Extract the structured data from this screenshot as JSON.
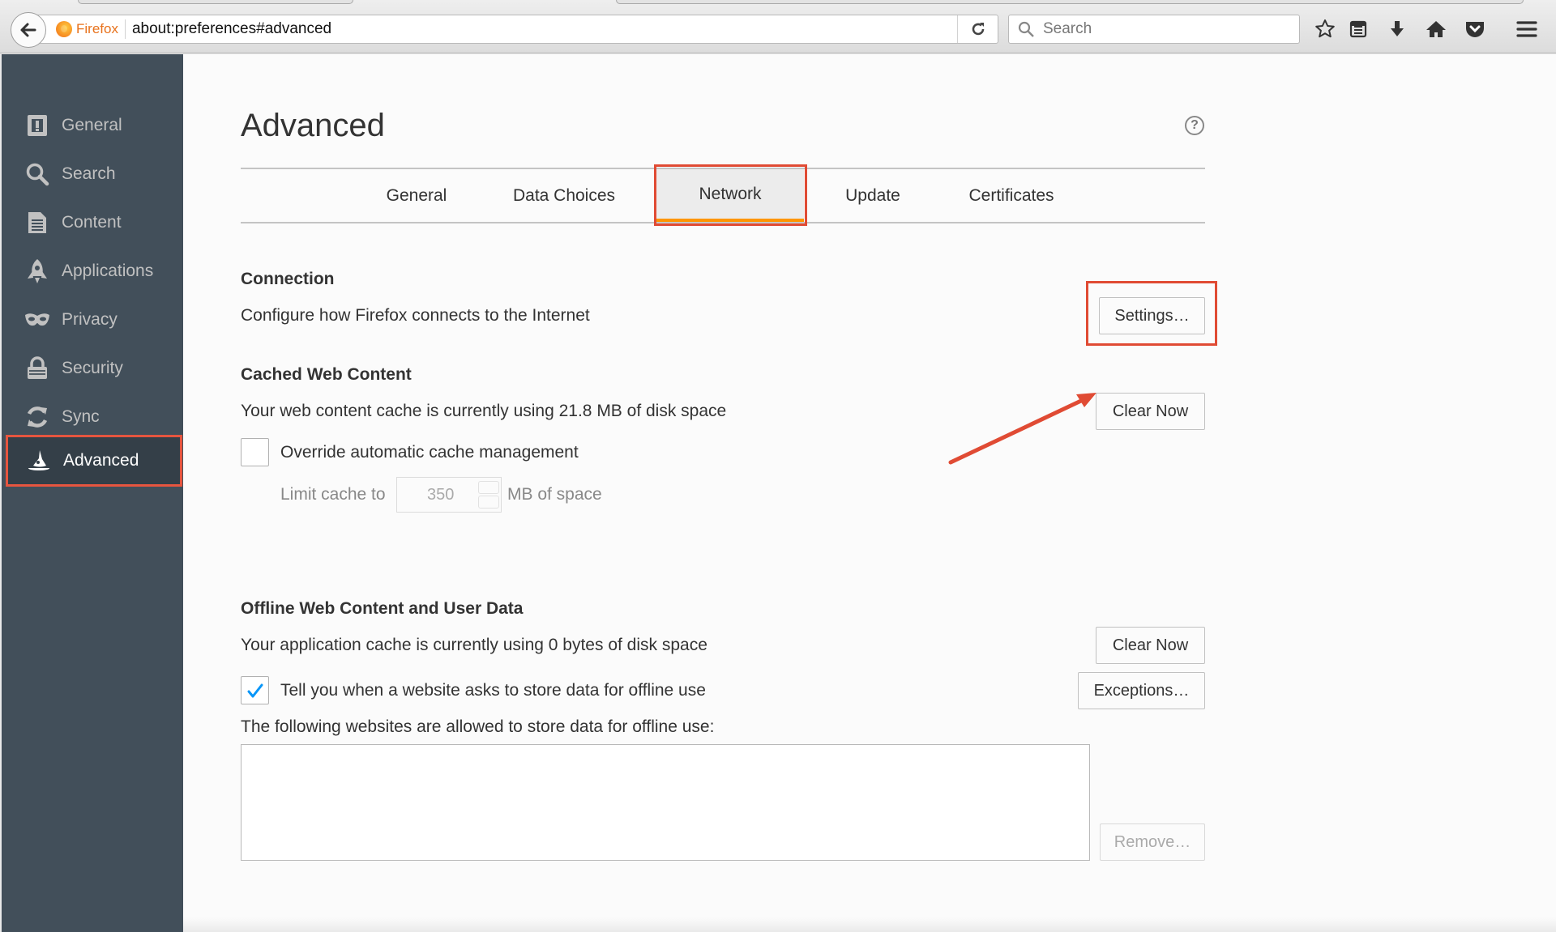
{
  "browser": {
    "identity_label": "Firefox",
    "url": "about:preferences#advanced",
    "search_placeholder": "Search"
  },
  "sidebar": {
    "items": [
      {
        "label": "General",
        "icon": "general-icon"
      },
      {
        "label": "Search",
        "icon": "search-icon"
      },
      {
        "label": "Content",
        "icon": "content-icon"
      },
      {
        "label": "Applications",
        "icon": "applications-icon"
      },
      {
        "label": "Privacy",
        "icon": "privacy-mask-icon"
      },
      {
        "label": "Security",
        "icon": "security-lock-icon"
      },
      {
        "label": "Sync",
        "icon": "sync-icon"
      },
      {
        "label": "Advanced",
        "icon": "advanced-wizard-icon",
        "selected": true
      }
    ]
  },
  "main": {
    "title": "Advanced",
    "tabs": [
      {
        "label": "General"
      },
      {
        "label": "Data Choices"
      },
      {
        "label": "Network",
        "selected": true
      },
      {
        "label": "Update"
      },
      {
        "label": "Certificates"
      }
    ],
    "connection": {
      "heading": "Connection",
      "description": "Configure how Firefox connects to the Internet",
      "settings_label": "Settings…"
    },
    "cache": {
      "heading": "Cached Web Content",
      "description": "Your web content cache is currently using 21.8 MB of disk space",
      "clear_label": "Clear Now",
      "override_label": "Override automatic cache management",
      "override_checked": false,
      "limit_label": "Limit cache to",
      "limit_value": "350",
      "limit_unit": "MB of space"
    },
    "offline": {
      "heading": "Offline Web Content and User Data",
      "description": "Your application cache is currently using 0 bytes of disk space",
      "clear_label": "Clear Now",
      "notify_label": "Tell you when a website asks to store data for offline use",
      "notify_checked": true,
      "exceptions_label": "Exceptions…",
      "allowed_label": "The following websites are allowed to store data for offline use:",
      "remove_label": "Remove…"
    }
  },
  "colors": {
    "sidebar_bg": "#424f5a",
    "highlight_red": "#e04b34",
    "tab_accent": "#ff9500",
    "checkbox_check": "#0996f8"
  }
}
